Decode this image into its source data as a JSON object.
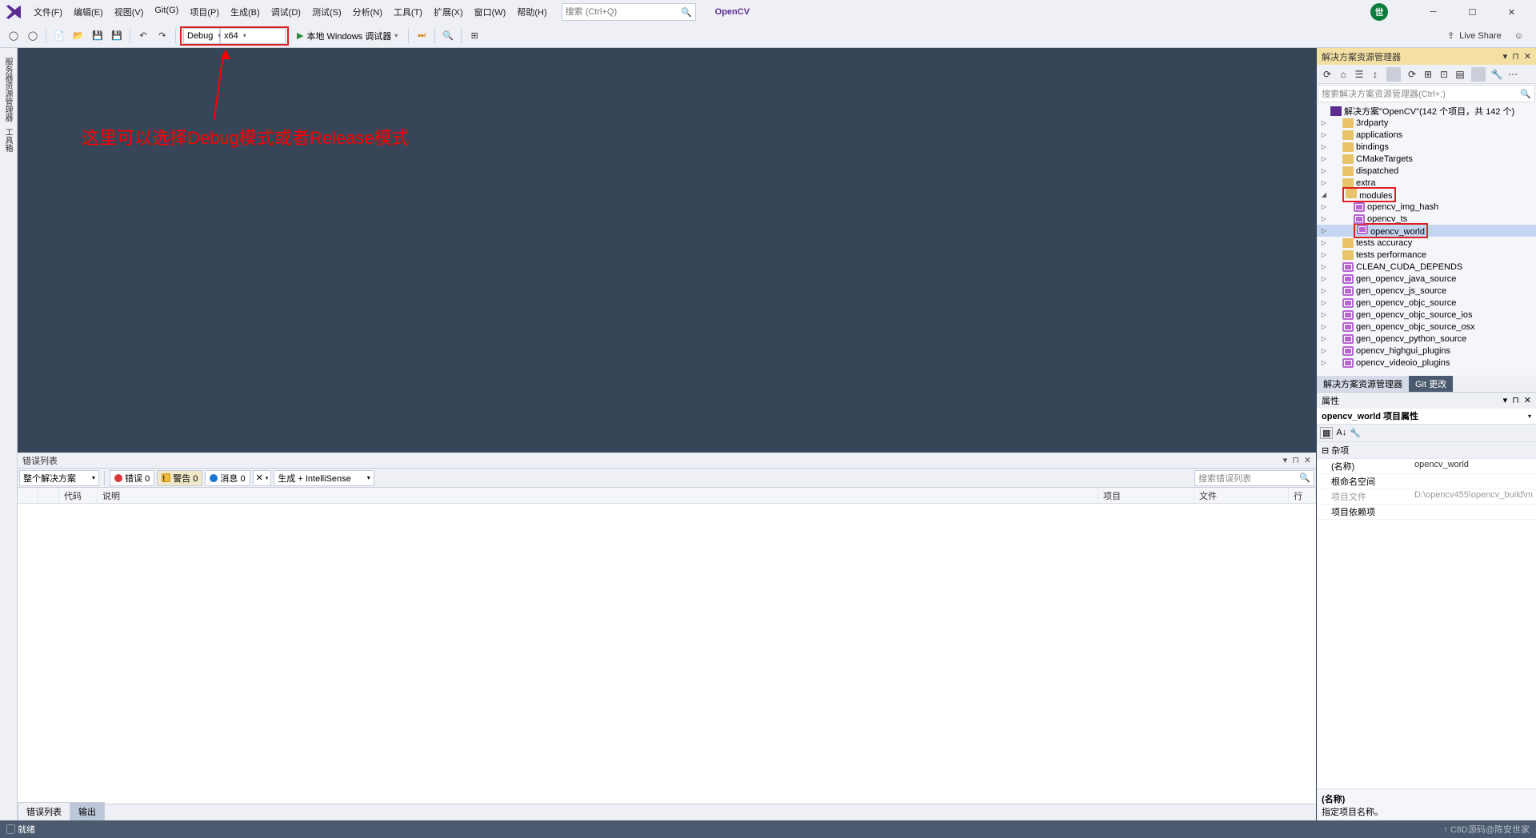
{
  "title": {
    "solution": "OpenCV"
  },
  "menu": {
    "file": "文件(F)",
    "edit": "编辑(E)",
    "view": "视图(V)",
    "git": "Git(G)",
    "project": "项目(P)",
    "build": "生成(B)",
    "debug": "调试(D)",
    "test": "测试(S)",
    "analyze": "分析(N)",
    "tools": "工具(T)",
    "extensions": "扩展(X)",
    "window": "窗口(W)",
    "help": "帮助(H)"
  },
  "search": {
    "placeholder": "搜索 (Ctrl+Q)"
  },
  "toolbar": {
    "config": "Debug",
    "platform": "x64",
    "debugger": "本地 Windows 调试器",
    "liveshare": "Live Share"
  },
  "annotation": {
    "text": "这里可以选择Debug模式或者Release模式"
  },
  "leftTool": {
    "server": "服务器资源管理器",
    "toolbox": "工具箱"
  },
  "errorList": {
    "title": "错误列表",
    "scope": "整个解决方案",
    "errors": "错误 0",
    "warnings": "警告 0",
    "messages": "消息 0",
    "source": "生成 + IntelliSense",
    "searchPlaceholder": "搜索错误列表",
    "cols": {
      "code": "代码",
      "desc": "说明",
      "project": "项目",
      "file": "文件",
      "line": "行"
    },
    "tabs": {
      "errorlist": "错误列表",
      "output": "输出"
    }
  },
  "solutionExplorer": {
    "title": "解决方案资源管理器",
    "searchPlaceholder": "搜索解决方案资源管理器(Ctrl+;)",
    "root": "解决方案\"OpenCV\"(142 个项目，共 142 个)",
    "folders": [
      {
        "name": "3rdparty"
      },
      {
        "name": "applications"
      },
      {
        "name": "bindings"
      },
      {
        "name": "CMakeTargets"
      },
      {
        "name": "dispatched"
      },
      {
        "name": "extra"
      }
    ],
    "modules": {
      "label": "modules",
      "items": [
        {
          "name": "opencv_img_hash"
        },
        {
          "name": "opencv_ts"
        },
        {
          "name": "opencv_world",
          "selected": true
        }
      ]
    },
    "rest": [
      {
        "name": "tests accuracy",
        "type": "folder"
      },
      {
        "name": "tests performance",
        "type": "folder"
      },
      {
        "name": "CLEAN_CUDA_DEPENDS",
        "type": "proj"
      },
      {
        "name": "gen_opencv_java_source",
        "type": "proj"
      },
      {
        "name": "gen_opencv_js_source",
        "type": "proj"
      },
      {
        "name": "gen_opencv_objc_source",
        "type": "proj"
      },
      {
        "name": "gen_opencv_objc_source_ios",
        "type": "proj"
      },
      {
        "name": "gen_opencv_objc_source_osx",
        "type": "proj"
      },
      {
        "name": "gen_opencv_python_source",
        "type": "proj"
      },
      {
        "name": "opencv_highgui_plugins",
        "type": "proj"
      },
      {
        "name": "opencv_videoio_plugins",
        "type": "proj"
      }
    ],
    "tabs": {
      "se": "解决方案资源管理器",
      "git": "Git 更改"
    }
  },
  "properties": {
    "title": "属性",
    "header": "opencv_world 项目属性",
    "category": "杂项",
    "rows": {
      "name": {
        "k": "(名称)",
        "v": "opencv_world"
      },
      "rootns": {
        "k": "根命名空间",
        "v": ""
      },
      "projfile": {
        "k": "项目文件",
        "v": "D:\\opencv455\\opencv_build\\m"
      },
      "deps": {
        "k": "项目依赖项",
        "v": ""
      }
    },
    "descTitle": "(名称)",
    "descText": "指定项目名称。"
  },
  "status": {
    "ready": "就绪",
    "watermark": "↑ C8D源码@陈安世家"
  }
}
